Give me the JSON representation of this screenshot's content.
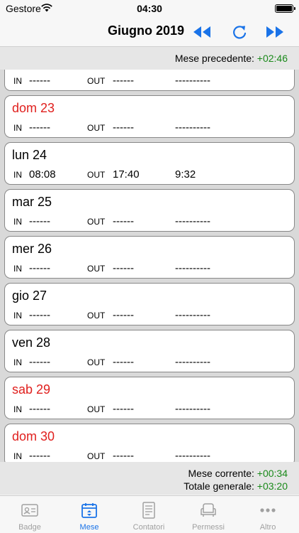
{
  "status_bar": {
    "carrier": "Gestore",
    "time": "04:30"
  },
  "nav": {
    "title": "Giugno 2019",
    "prev_icon": "double-arrow-left-icon",
    "refresh_icon": "refresh-icon",
    "next_icon": "double-arrow-right-icon"
  },
  "previous_month": {
    "label": "Mese precedente:",
    "value": "+02:46"
  },
  "days": [
    {
      "label": "",
      "weekend": false,
      "in_label": "IN",
      "in": "------",
      "out_label": "OUT",
      "out": "------",
      "total": "----------"
    },
    {
      "label": "dom 23",
      "weekend": true,
      "in_label": "IN",
      "in": "------",
      "out_label": "OUT",
      "out": "------",
      "total": "----------"
    },
    {
      "label": "lun 24",
      "weekend": false,
      "in_label": "IN",
      "in": "08:08",
      "out_label": "OUT",
      "out": "17:40",
      "total": "9:32"
    },
    {
      "label": "mar 25",
      "weekend": false,
      "in_label": "IN",
      "in": "------",
      "out_label": "OUT",
      "out": "------",
      "total": "----------"
    },
    {
      "label": "mer 26",
      "weekend": false,
      "in_label": "IN",
      "in": "------",
      "out_label": "OUT",
      "out": "------",
      "total": "----------"
    },
    {
      "label": "gio 27",
      "weekend": false,
      "in_label": "IN",
      "in": "------",
      "out_label": "OUT",
      "out": "------",
      "total": "----------"
    },
    {
      "label": "ven 28",
      "weekend": false,
      "in_label": "IN",
      "in": "------",
      "out_label": "OUT",
      "out": "------",
      "total": "----------"
    },
    {
      "label": "sab 29",
      "weekend": true,
      "in_label": "IN",
      "in": "------",
      "out_label": "OUT",
      "out": "------",
      "total": "----------"
    },
    {
      "label": "dom 30",
      "weekend": true,
      "in_label": "IN",
      "in": "------",
      "out_label": "OUT",
      "out": "------",
      "total": "----------"
    }
  ],
  "totals": {
    "current_label": "Mese corrente:",
    "current_value": "+00:34",
    "general_label": "Totale generale:",
    "general_value": "+03:20"
  },
  "tabs": [
    {
      "label": "Badge",
      "icon": "badge-card-icon",
      "active": false
    },
    {
      "label": "Mese",
      "icon": "calendar-icon",
      "active": true
    },
    {
      "label": "Contatori",
      "icon": "document-icon",
      "active": false
    },
    {
      "label": "Permessi",
      "icon": "armchair-icon",
      "active": false
    },
    {
      "label": "Altro",
      "icon": "more-dots-icon",
      "active": false
    }
  ],
  "colors": {
    "accent": "#1a73e8",
    "weekend": "#e0201e",
    "positive": "#1a8a1a"
  }
}
